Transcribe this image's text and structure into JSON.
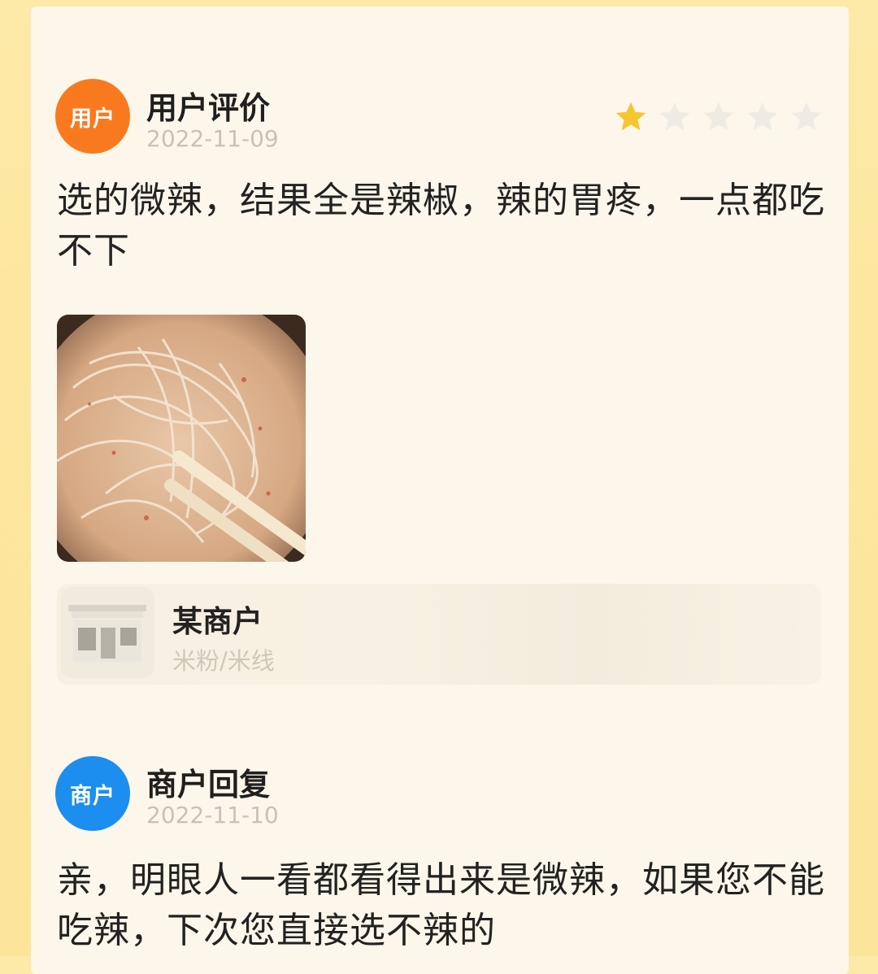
{
  "review": {
    "avatar_label": "用户",
    "title": "用户评价",
    "date": "2022-11-09",
    "rating": {
      "value": 1,
      "max": 5
    },
    "text": "选的微辣，结果全是辣椒，辣的胃疼，一点都吃不下",
    "photo_icon": "rice-noodle-bowl-photo"
  },
  "shop": {
    "name": "某商户",
    "category": "米粉/米线",
    "icon": "storefront-icon"
  },
  "reply": {
    "avatar_label": "商户",
    "title": "商户回复",
    "date": "2022-11-10",
    "text": "亲，明眼人一看都看得出来是微辣，如果您不能吃辣，下次您直接选不辣的"
  },
  "colors": {
    "user_avatar": "#f97a1e",
    "merchant_avatar": "#1c8ef0",
    "star_filled": "#f7c531",
    "star_empty": "#eeebe5"
  }
}
